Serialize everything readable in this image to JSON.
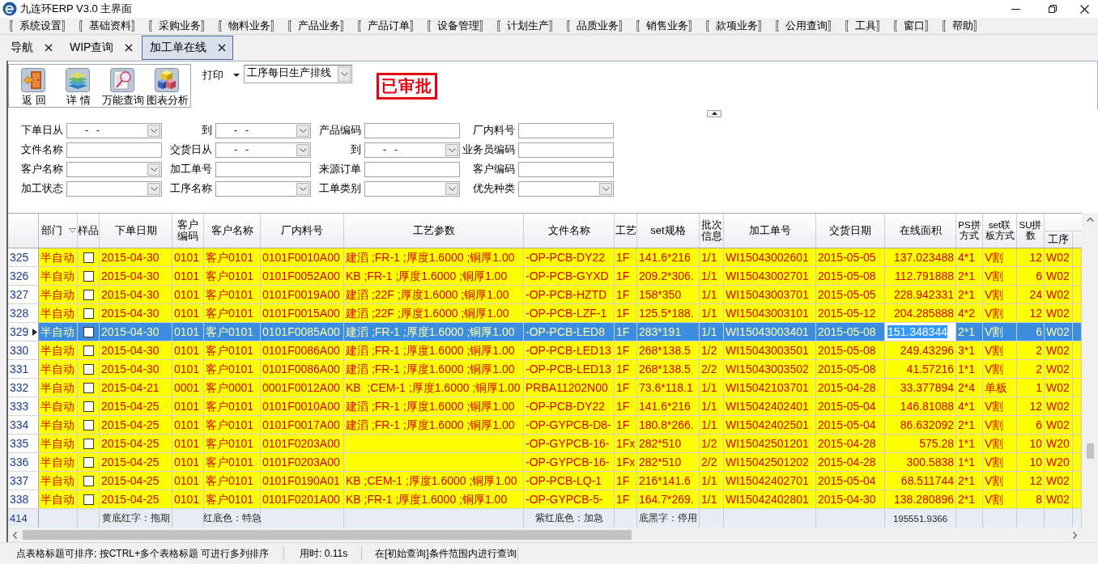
{
  "window": {
    "title": "九连环ERP V3.0 主界面"
  },
  "menu": [
    "〚系统设置〛",
    "〚基础资料〛",
    "〚采购业务〛",
    "〚物料业务〛",
    "〚产品业务〛",
    "〚产品订单〛",
    "〚设备管理〛",
    "〚计划生产〛",
    "〚品质业务〛",
    "〚销售业务〛",
    "〚款项业务〛",
    "〚公用查询〛",
    "〚工具〛",
    "〚窗口〛",
    "〚帮助〛"
  ],
  "tabs": [
    {
      "label": "导航",
      "selected": false
    },
    {
      "label": "WIP查询",
      "selected": false
    },
    {
      "label": "加工单在线",
      "selected": true
    }
  ],
  "toolbar": [
    {
      "label": "返 回",
      "kind": "back"
    },
    {
      "label": "详 情",
      "kind": "detail"
    },
    {
      "label": "万能查询",
      "kind": "query"
    },
    {
      "label": "图表分析",
      "kind": "chart"
    }
  ],
  "print": {
    "label": "打印",
    "report": "工序每日生产排线"
  },
  "approval_stamp": "已审批",
  "filters": [
    {
      "label": "下单日从",
      "kind": "date",
      "value": "-   -"
    },
    {
      "label": "到",
      "kind": "date",
      "value": "-   -"
    },
    {
      "label": "产品编码",
      "kind": "text"
    },
    {
      "label": "厂内料号",
      "kind": "text"
    },
    {
      "label": "文件名称",
      "kind": "text"
    },
    {
      "label": "交货日从",
      "kind": "date",
      "value": "-   -"
    },
    {
      "label": "到",
      "kind": "date",
      "value": "-   -"
    },
    {
      "label": "业务员编码",
      "kind": "text"
    },
    {
      "label": "客户名称",
      "kind": "combo"
    },
    {
      "label": "加工单号",
      "kind": "text"
    },
    {
      "label": "来源订单",
      "kind": "text"
    },
    {
      "label": "客户编码",
      "kind": "text"
    },
    {
      "label": "加工状态",
      "kind": "combo"
    },
    {
      "label": "工序名称",
      "kind": "combo"
    },
    {
      "label": "工单类别",
      "kind": "combo"
    },
    {
      "label": "优先种类",
      "kind": "combo"
    }
  ],
  "table": {
    "columns": [
      {
        "label": "部门",
        "kind": "text",
        "sorted": true,
        "current": false
      },
      {
        "label": "样品",
        "kind": "check",
        "sorted": false,
        "current": false
      },
      {
        "label": "下单日期",
        "kind": "text",
        "sorted": false,
        "current": false
      },
      {
        "label": "客户编码",
        "kind": "text",
        "sorted": false,
        "current": false
      },
      {
        "label": "客户名称",
        "kind": "text",
        "sorted": false,
        "current": false
      },
      {
        "label": "厂内料号",
        "kind": "text",
        "sorted": false,
        "current": false
      },
      {
        "label": "工艺参数",
        "kind": "text",
        "sorted": false,
        "current": false
      },
      {
        "label": "文件名称",
        "kind": "text",
        "sorted": false,
        "current": false
      },
      {
        "label": "工艺",
        "kind": "text",
        "sorted": false,
        "current": false
      },
      {
        "label": "set规格",
        "kind": "text",
        "sorted": false,
        "current": false
      },
      {
        "label": "批次信息",
        "kind": "text",
        "sorted": false,
        "current": false
      },
      {
        "label": "加工单号",
        "kind": "text",
        "sorted": false,
        "current": false
      },
      {
        "label": "交货日期",
        "kind": "text",
        "sorted": false,
        "current": false
      },
      {
        "label": "在线面积",
        "kind": "number",
        "sorted": false,
        "current": true
      },
      {
        "label": "PS拼方式",
        "kind": "text",
        "sorted": false,
        "current": false
      },
      {
        "label": "set联板方式",
        "kind": "text",
        "sorted": false,
        "current": false
      },
      {
        "label": "SU拼数",
        "kind": "number",
        "sorted": false,
        "current": false
      },
      {
        "label": "工序",
        "kind": "text",
        "sorted": false,
        "current": false
      }
    ],
    "rows": [
      {
        "number": "325",
        "selected": false,
        "checked": false,
        "cells": [
          "半自动",
          null,
          "2015-04-30",
          "0101",
          "客户0101",
          "0101F0010A00",
          "建滔 ;FR-1 ;厚度1.6000 ;铜厚1.00",
          "-OP-PCB-DY22",
          "1F",
          "141.6*216",
          "1/1",
          "WI15043002601",
          "2015-05-05",
          "137.023488",
          "4*1",
          "V割",
          "12",
          "W02"
        ]
      },
      {
        "number": "326",
        "selected": false,
        "checked": false,
        "cells": [
          "半自动",
          null,
          "2015-04-30",
          "0101",
          "客户0101",
          "0101F0052A00",
          "KB ;FR-1 ;厚度1.6000 ;铜厚1.00",
          "-OP-PCB-GYXD",
          "1F",
          "209.2*306.",
          "1/1",
          "WI15043002701",
          "2015-05-08",
          "112.791888",
          "2*1",
          "V割",
          "6",
          "W02"
        ]
      },
      {
        "number": "327",
        "selected": false,
        "checked": false,
        "cells": [
          "半自动",
          null,
          "2015-04-30",
          "0101",
          "客户0101",
          "0101F0019A00",
          "建滔 ;22F ;厚度1.6000 ;铜厚1.00",
          "-OP-PCB-HZTD",
          "1F",
          "158*350",
          "1/1",
          "WI15043003701",
          "2015-05-05",
          "228.942331",
          "2*1",
          "V割",
          "24",
          "W02"
        ]
      },
      {
        "number": "328",
        "selected": false,
        "checked": false,
        "cells": [
          "半自动",
          null,
          "2015-04-30",
          "0101",
          "客户0101",
          "0101F0015A00",
          "建滔 ;22F ;厚度1.6000 ;铜厚1.00",
          "-OP-PCB-LZF-1",
          "1F",
          "125.5*188.",
          "1/1",
          "WI15043003101",
          "2015-05-12",
          "204.285888",
          "4*2",
          "V割",
          "12",
          "W02"
        ]
      },
      {
        "number": "329",
        "selected": true,
        "checked": false,
        "cells": [
          "半自动",
          null,
          "2015-04-30",
          "0101",
          "客户0101",
          "0101F0085A00",
          "建滔 ;FR-1 ;厚度1.6000 ;铜厚1.00",
          "-OP-PCB-LED8",
          "1F",
          "283*191",
          "1/1",
          "WI15043003401",
          "2015-05-08",
          "151.348344",
          "2*1",
          "V割",
          "6",
          "W02"
        ]
      },
      {
        "number": "330",
        "selected": false,
        "checked": false,
        "cells": [
          "半自动",
          null,
          "2015-04-30",
          "0101",
          "客户0101",
          "0101F0086A00",
          "建滔 ;FR-1 ;厚度1.6000 ;铜厚1.00",
          "-OP-PCB-LED13",
          "1F",
          "268*138.5",
          "1/2",
          "WI15043003501",
          "2015-05-08",
          "249.43296",
          "3*1",
          "V割",
          "2",
          "W02"
        ]
      },
      {
        "number": "331",
        "selected": false,
        "checked": false,
        "cells": [
          "半自动",
          null,
          "2015-04-30",
          "0101",
          "客户0101",
          "0101F0086A00",
          "建滔 ;FR-1 ;厚度1.6000 ;铜厚1.00",
          "-OP-PCB-LED13",
          "1F",
          "268*138.5",
          "2/2",
          "WI15043003502",
          "2015-05-08",
          "41.57216",
          "1*1",
          "V割",
          "2",
          "W02"
        ]
      },
      {
        "number": "332",
        "selected": false,
        "checked": false,
        "cells": [
          "半自动",
          null,
          "2015-04-21",
          "0001",
          "客户0001",
          "0001F0012A00",
          "KB  ;CEM-1 ;厚度1.6000 ;铜厚1.00",
          "PRBA11202N00",
          "1F",
          "73.6*118.1",
          "1/1",
          "WI15042103701",
          "2015-04-28",
          "33.377894",
          "2*4",
          "单板",
          "1",
          "W02"
        ]
      },
      {
        "number": "333",
        "selected": false,
        "checked": false,
        "cells": [
          "半自动",
          null,
          "2015-04-25",
          "0101",
          "客户0101",
          "0101F0010A00",
          "建滔 ;FR-1 ;厚度1.6000 ;铜厚1.00",
          "-OP-PCB-DY22",
          "1F",
          "141.6*216",
          "1/1",
          "WI15042402401",
          "2015-05-04",
          "146.81088",
          "4*1",
          "V割",
          "12",
          "W02"
        ]
      },
      {
        "number": "334",
        "selected": false,
        "checked": false,
        "cells": [
          "半自动",
          null,
          "2015-04-25",
          "0101",
          "客户0101",
          "0101F0017A00",
          "建滔 ;FR-1 ;厚度1.6000 ;铜厚1.00",
          "-OP-GYPCB-D8-",
          "1F",
          "180.8*266.",
          "1/1",
          "WI15042402501",
          "2015-05-04",
          "86.632092",
          "2*1",
          "V割",
          "6",
          "W02"
        ]
      },
      {
        "number": "335",
        "selected": false,
        "checked": false,
        "cells": [
          "半自动",
          null,
          "2015-04-25",
          "0101",
          "客户0101",
          "0101F0203A00",
          null,
          "-OP-GYPCB-16-",
          "1Fx",
          "282*510",
          "1/2",
          "WI15042501201",
          "2015-04-28",
          "575.28",
          "1*1",
          "V割",
          "10",
          "W20"
        ]
      },
      {
        "number": "336",
        "selected": false,
        "checked": false,
        "cells": [
          "半自动",
          null,
          "2015-04-25",
          "0101",
          "客户0101",
          "0101F0203A00",
          null,
          "-OP-GYPCB-16-",
          "1Fx",
          "282*510",
          "2/2",
          "WI15042501202",
          "2015-04-28",
          "300.5838",
          "1*1",
          "V割",
          "10",
          "W20"
        ]
      },
      {
        "number": "337",
        "selected": false,
        "checked": false,
        "cells": [
          "半自动",
          null,
          "2015-04-25",
          "0101",
          "客户0101",
          "0101F0190A01",
          "KB ;CEM-1 ;厚度1.6000 ;铜厚1.00",
          "-OP-PCB-LQ-1",
          "1F",
          "216*141.6",
          "1/1",
          "WI15042402701",
          "2015-05-04",
          "68.511744",
          "2*1",
          "V割",
          "12",
          "W02"
        ]
      },
      {
        "number": "338",
        "selected": false,
        "checked": false,
        "cells": [
          "半自动",
          null,
          "2015-04-25",
          "0101",
          "客户0101",
          "0101F0201A00",
          "KB ;FR-1 ;厚度1.6000 ;铜厚1.00",
          "-OP-GYPCB-5-",
          "1F",
          "164.7*269.",
          "1/1",
          "WI15042402801",
          "2015-04-30",
          "138.280896",
          "2*1",
          "V割",
          "8",
          "W02"
        ]
      }
    ],
    "footer": {
      "number": "414",
      "cells": [
        null,
        null,
        "黄底红字：拖期",
        null,
        "红底色：特急",
        null,
        null,
        "紫红底色：加急",
        null,
        "底黑字：停用",
        null,
        null,
        null,
        "195551.9366",
        null,
        null,
        null,
        null
      ]
    }
  },
  "status_bar": [
    "点表格标题可排序; 按CTRL+多个表格标题 可进行多列排序",
    "用时: 0.11s",
    "在[初始查询]条件范围内进行查询"
  ]
}
